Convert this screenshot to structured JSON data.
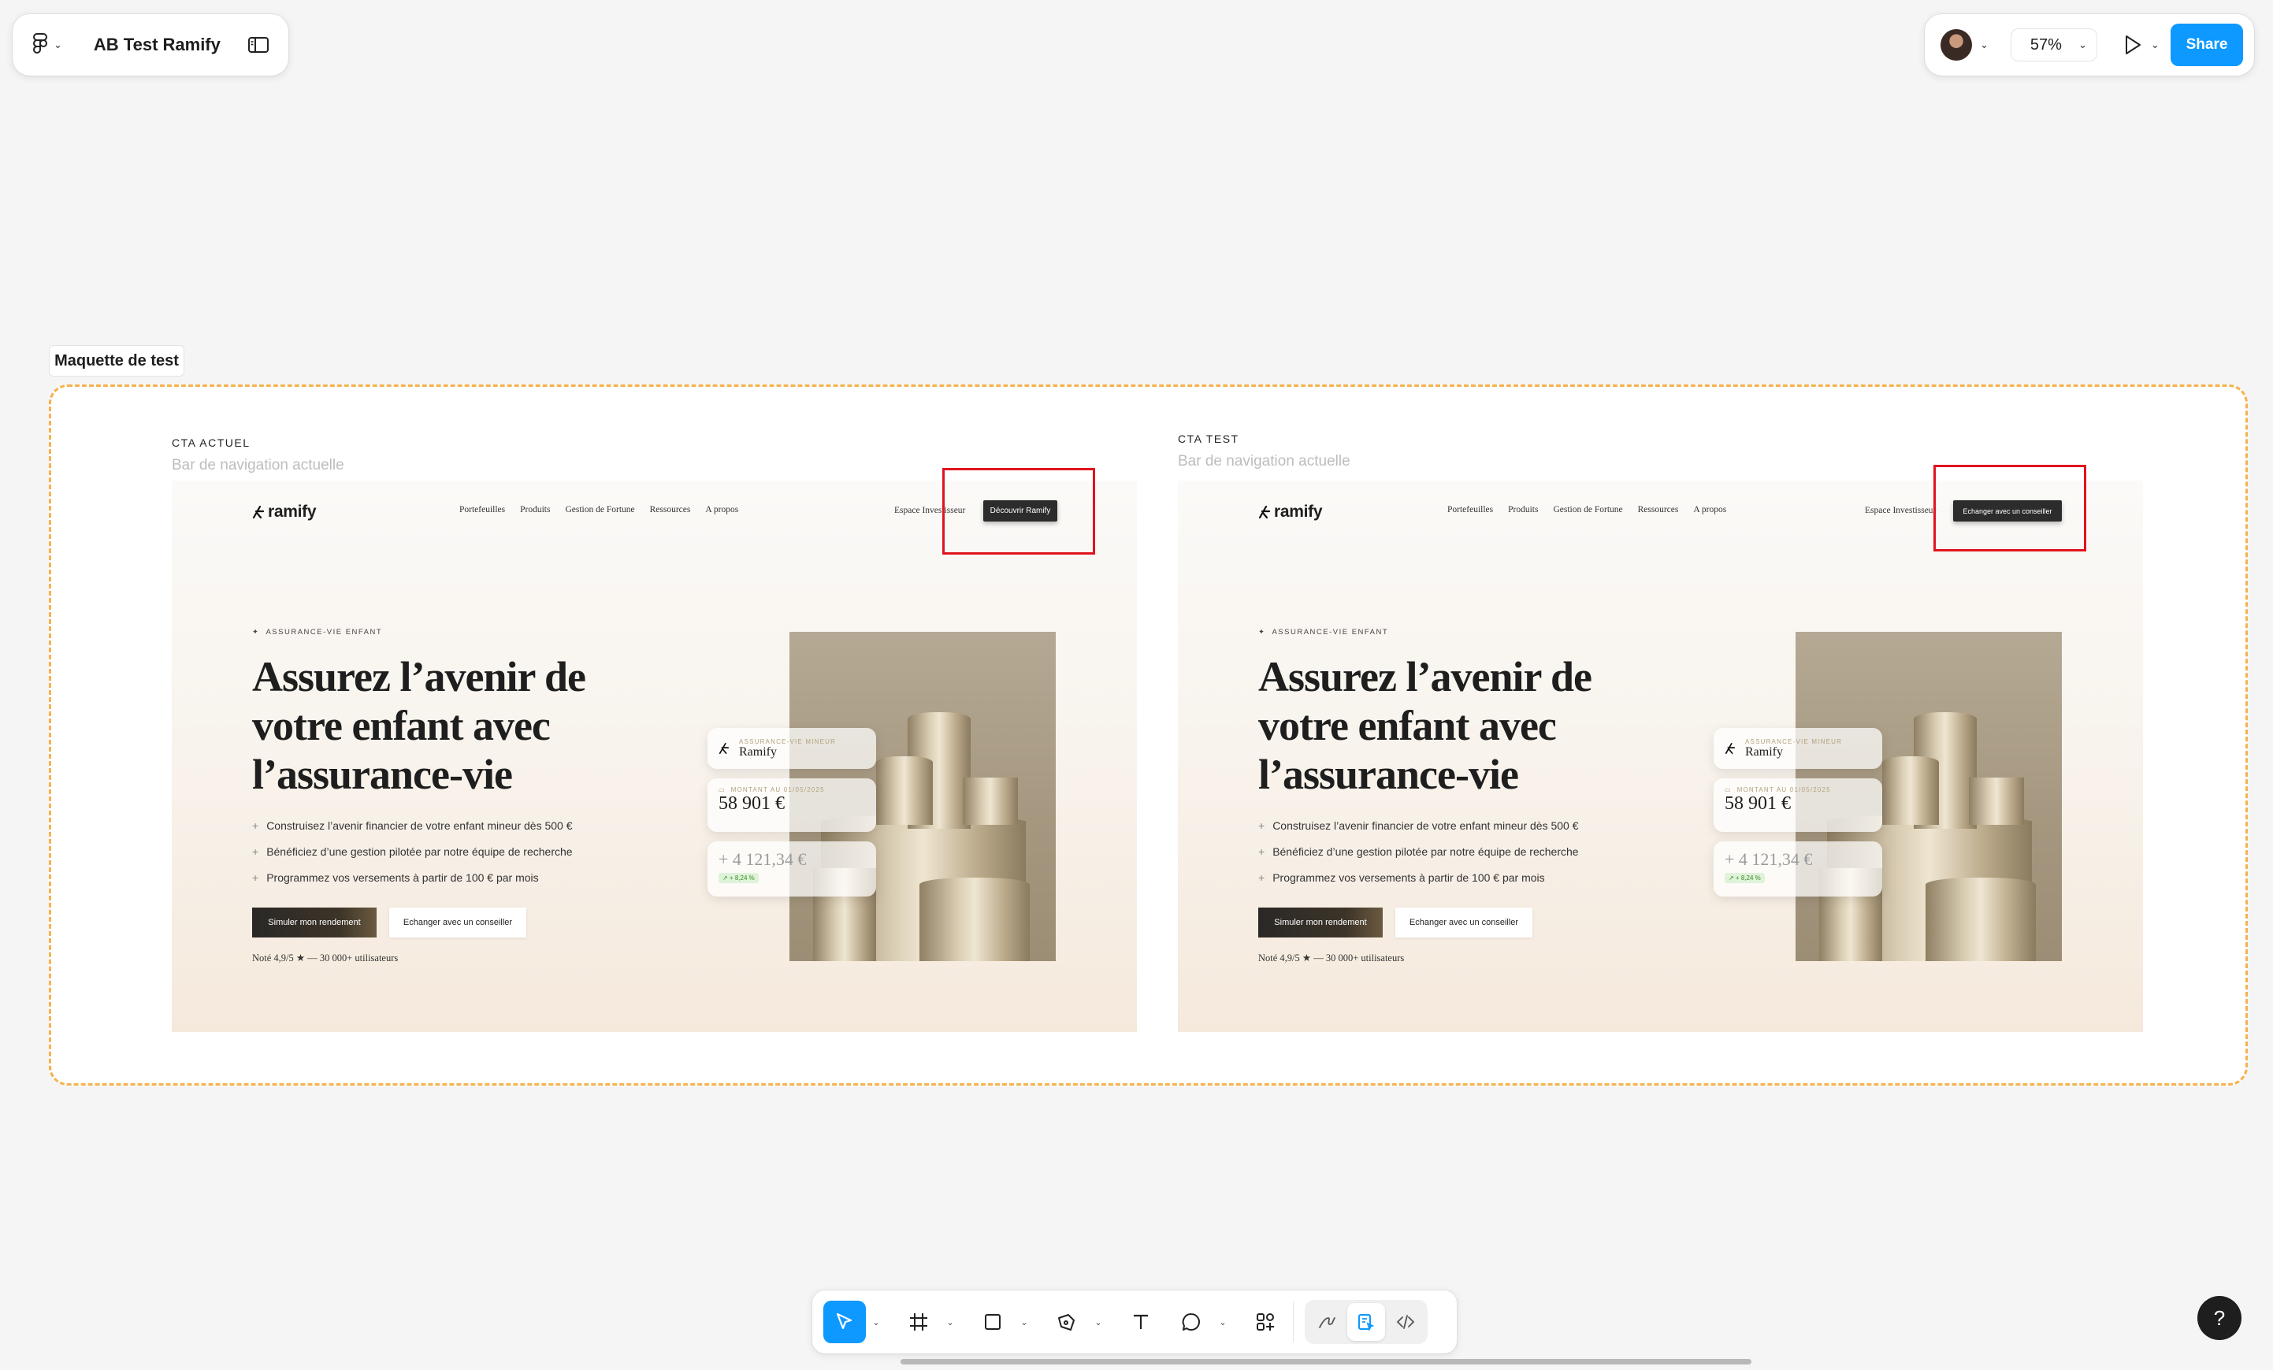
{
  "file": {
    "name": "AB Test Ramify"
  },
  "top_right": {
    "zoom": "57%",
    "share_label": "Share"
  },
  "section": {
    "label": "Maquette de test"
  },
  "variants": [
    {
      "tag": "CTA ACTUEL",
      "subtitle": "Bar de navigation actuelle",
      "nav": {
        "logo": "ramify",
        "links": [
          "Portefeuilles",
          "Produits",
          "Gestion de Fortune",
          "Ressources",
          "A propos"
        ],
        "espace": "Espace Investisseur",
        "cta": "Découvrir Ramify"
      },
      "hero": {
        "badge": "ASSURANCE-VIE ENFANT",
        "title": "Assurez l’avenir de votre enfant avec l’assurance-vie",
        "bullets": [
          "Construisez l’avenir financier de votre enfant mineur dès 500 €",
          "Bénéficiez d’une gestion pilotée par notre équipe de recherche",
          "Programmez vos versements à partir de 100 € par mois"
        ],
        "primary_button": "Simuler mon rendement",
        "secondary_button": "Echanger avec un conseiller",
        "rating": "Noté 4,9/5 ★ — 30 000+ utilisateurs"
      },
      "cards": {
        "card1_small": "ASSURANCE-VIE MINEUR",
        "card1_big": "Ramify",
        "card2_small": "MONTANT AU 01/05/2025",
        "card2_big": "58 901 €",
        "card3_big": "+ 4 121,34 €",
        "card3_pct": "↗ + 8,24 %"
      }
    },
    {
      "tag": "CTA TEST",
      "subtitle": "Bar de navigation actuelle",
      "nav": {
        "logo": "ramify",
        "links": [
          "Portefeuilles",
          "Produits",
          "Gestion de Fortune",
          "Ressources",
          "A propos"
        ],
        "espace": "Espace Investisseur",
        "cta": "Echanger avec un conseiller"
      },
      "hero": {
        "badge": "ASSURANCE-VIE ENFANT",
        "title": "Assurez l’avenir de votre enfant avec l’assurance-vie",
        "bullets": [
          "Construisez l’avenir financier de votre enfant mineur dès 500 €",
          "Bénéficiez d’une gestion pilotée par notre équipe de recherche",
          "Programmez vos versements à partir de 100 € par mois"
        ],
        "primary_button": "Simuler mon rendement",
        "secondary_button": "Echanger avec un conseiller",
        "rating": "Noté 4,9/5 ★ — 30 000+ utilisateurs"
      },
      "cards": {
        "card1_small": "ASSURANCE-VIE MINEUR",
        "card1_big": "Ramify",
        "card2_small": "MONTANT AU 01/05/2025",
        "card2_big": "58 901 €",
        "card3_big": "+ 4 121,34 €",
        "card3_pct": "↗ + 8,24 %"
      }
    }
  ],
  "toolbar": {
    "tools": [
      "move-tool",
      "frame-tool",
      "shape-tool",
      "pen-tool",
      "text-tool",
      "comment-tool",
      "actions-tool"
    ],
    "modes": [
      "draw-mode",
      "design-mode",
      "dev-mode"
    ]
  },
  "help": {
    "label": "?"
  },
  "colors": {
    "accent": "#0d99ff",
    "section_border": "#f6b24e",
    "highlight": "#e0141e",
    "cta_dark": "#2c2c2c"
  }
}
